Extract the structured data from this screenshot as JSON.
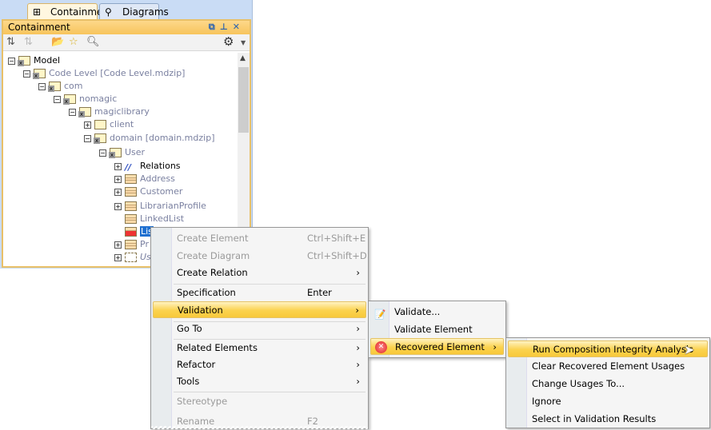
{
  "tabs": [
    {
      "label": "Containment",
      "icon": "containment-icon"
    },
    {
      "label": "Diagrams",
      "icon": "diagrams-icon"
    }
  ],
  "panel": {
    "title": "Containment",
    "header_buttons": [
      "undock-icon",
      "pin-icon",
      "close-icon"
    ]
  },
  "toolbar": [
    "collapse-icon",
    "expand-icon",
    "open-folder-icon",
    "favorite-star-icon",
    "search-icon",
    "gear-icon",
    "dropdown-arrow-icon"
  ],
  "tree": [
    {
      "label": "Model",
      "level": 0,
      "expander": "-",
      "icon": "model",
      "style": "normal"
    },
    {
      "label": "Code Level [Code Level.mdzip]",
      "level": 1,
      "expander": "-",
      "icon": "package",
      "style": "dim"
    },
    {
      "label": "com",
      "level": 2,
      "expander": "-",
      "icon": "package",
      "style": "dim"
    },
    {
      "label": "nomagic",
      "level": 3,
      "expander": "-",
      "icon": "package",
      "style": "dim"
    },
    {
      "label": "magiclibrary",
      "level": 4,
      "expander": "-",
      "icon": "package",
      "style": "dim"
    },
    {
      "label": "client",
      "level": 5,
      "expander": "+",
      "icon": "folder",
      "style": "dim"
    },
    {
      "label": "domain [domain.mdzip]",
      "level": 5,
      "expander": "-",
      "icon": "package",
      "style": "dim"
    },
    {
      "label": "User",
      "level": 6,
      "expander": "-",
      "icon": "package",
      "style": "dim"
    },
    {
      "label": "Relations",
      "level": 7,
      "expander": "+",
      "icon": "relation",
      "style": "normal"
    },
    {
      "label": "Address",
      "level": 7,
      "expander": "+",
      "icon": "class",
      "style": "dim"
    },
    {
      "label": "Customer",
      "level": 7,
      "expander": "+",
      "icon": "class",
      "style": "dim"
    },
    {
      "label": "LibrarianProfile",
      "level": 7,
      "expander": "+",
      "icon": "class",
      "style": "dim"
    },
    {
      "label": "LinkedList",
      "level": 7,
      "expander": "",
      "icon": "class",
      "style": "dim"
    },
    {
      "label": "Lis",
      "level": 7,
      "expander": "",
      "icon": "class",
      "style": "sel"
    },
    {
      "label": "Pr",
      "level": 7,
      "expander": "+",
      "icon": "class",
      "style": "dim"
    },
    {
      "label": "Us",
      "level": 7,
      "expander": "+",
      "icon": "interface",
      "style": "dim"
    }
  ],
  "context_menu": [
    {
      "label": "Create Element",
      "shortcut": "Ctrl+Shift+E",
      "disabled": true
    },
    {
      "label": "Create Diagram",
      "shortcut": "Ctrl+Shift+D",
      "disabled": true
    },
    {
      "label": "Create Relation",
      "submenu": true
    },
    {
      "label": "Specification",
      "shortcut": "Enter"
    },
    {
      "label": "Validation",
      "submenu": true,
      "highlighted": true
    },
    {
      "label": "Go To",
      "submenu": true
    },
    {
      "label": "Related Elements",
      "submenu": true
    },
    {
      "label": "Refactor",
      "submenu": true
    },
    {
      "label": "Tools",
      "submenu": true
    },
    {
      "label": "Stereotype",
      "disabled": true
    },
    {
      "label": "Rename",
      "shortcut": "F2",
      "disabled": true
    }
  ],
  "validation_menu": [
    {
      "label": "Validate...",
      "icon": "validate-icon"
    },
    {
      "label": "Validate Element"
    },
    {
      "label": "Recovered Element",
      "icon": "error-icon",
      "submenu": true,
      "highlighted": true
    }
  ],
  "recovered_menu": [
    {
      "label": "Run Composition Integrity Analysis",
      "highlighted": true
    },
    {
      "label": "Clear Recovered Element Usages"
    },
    {
      "label": "Change Usages To..."
    },
    {
      "label": "Ignore"
    },
    {
      "label": "Select in Validation Results"
    }
  ],
  "arrow": "›"
}
